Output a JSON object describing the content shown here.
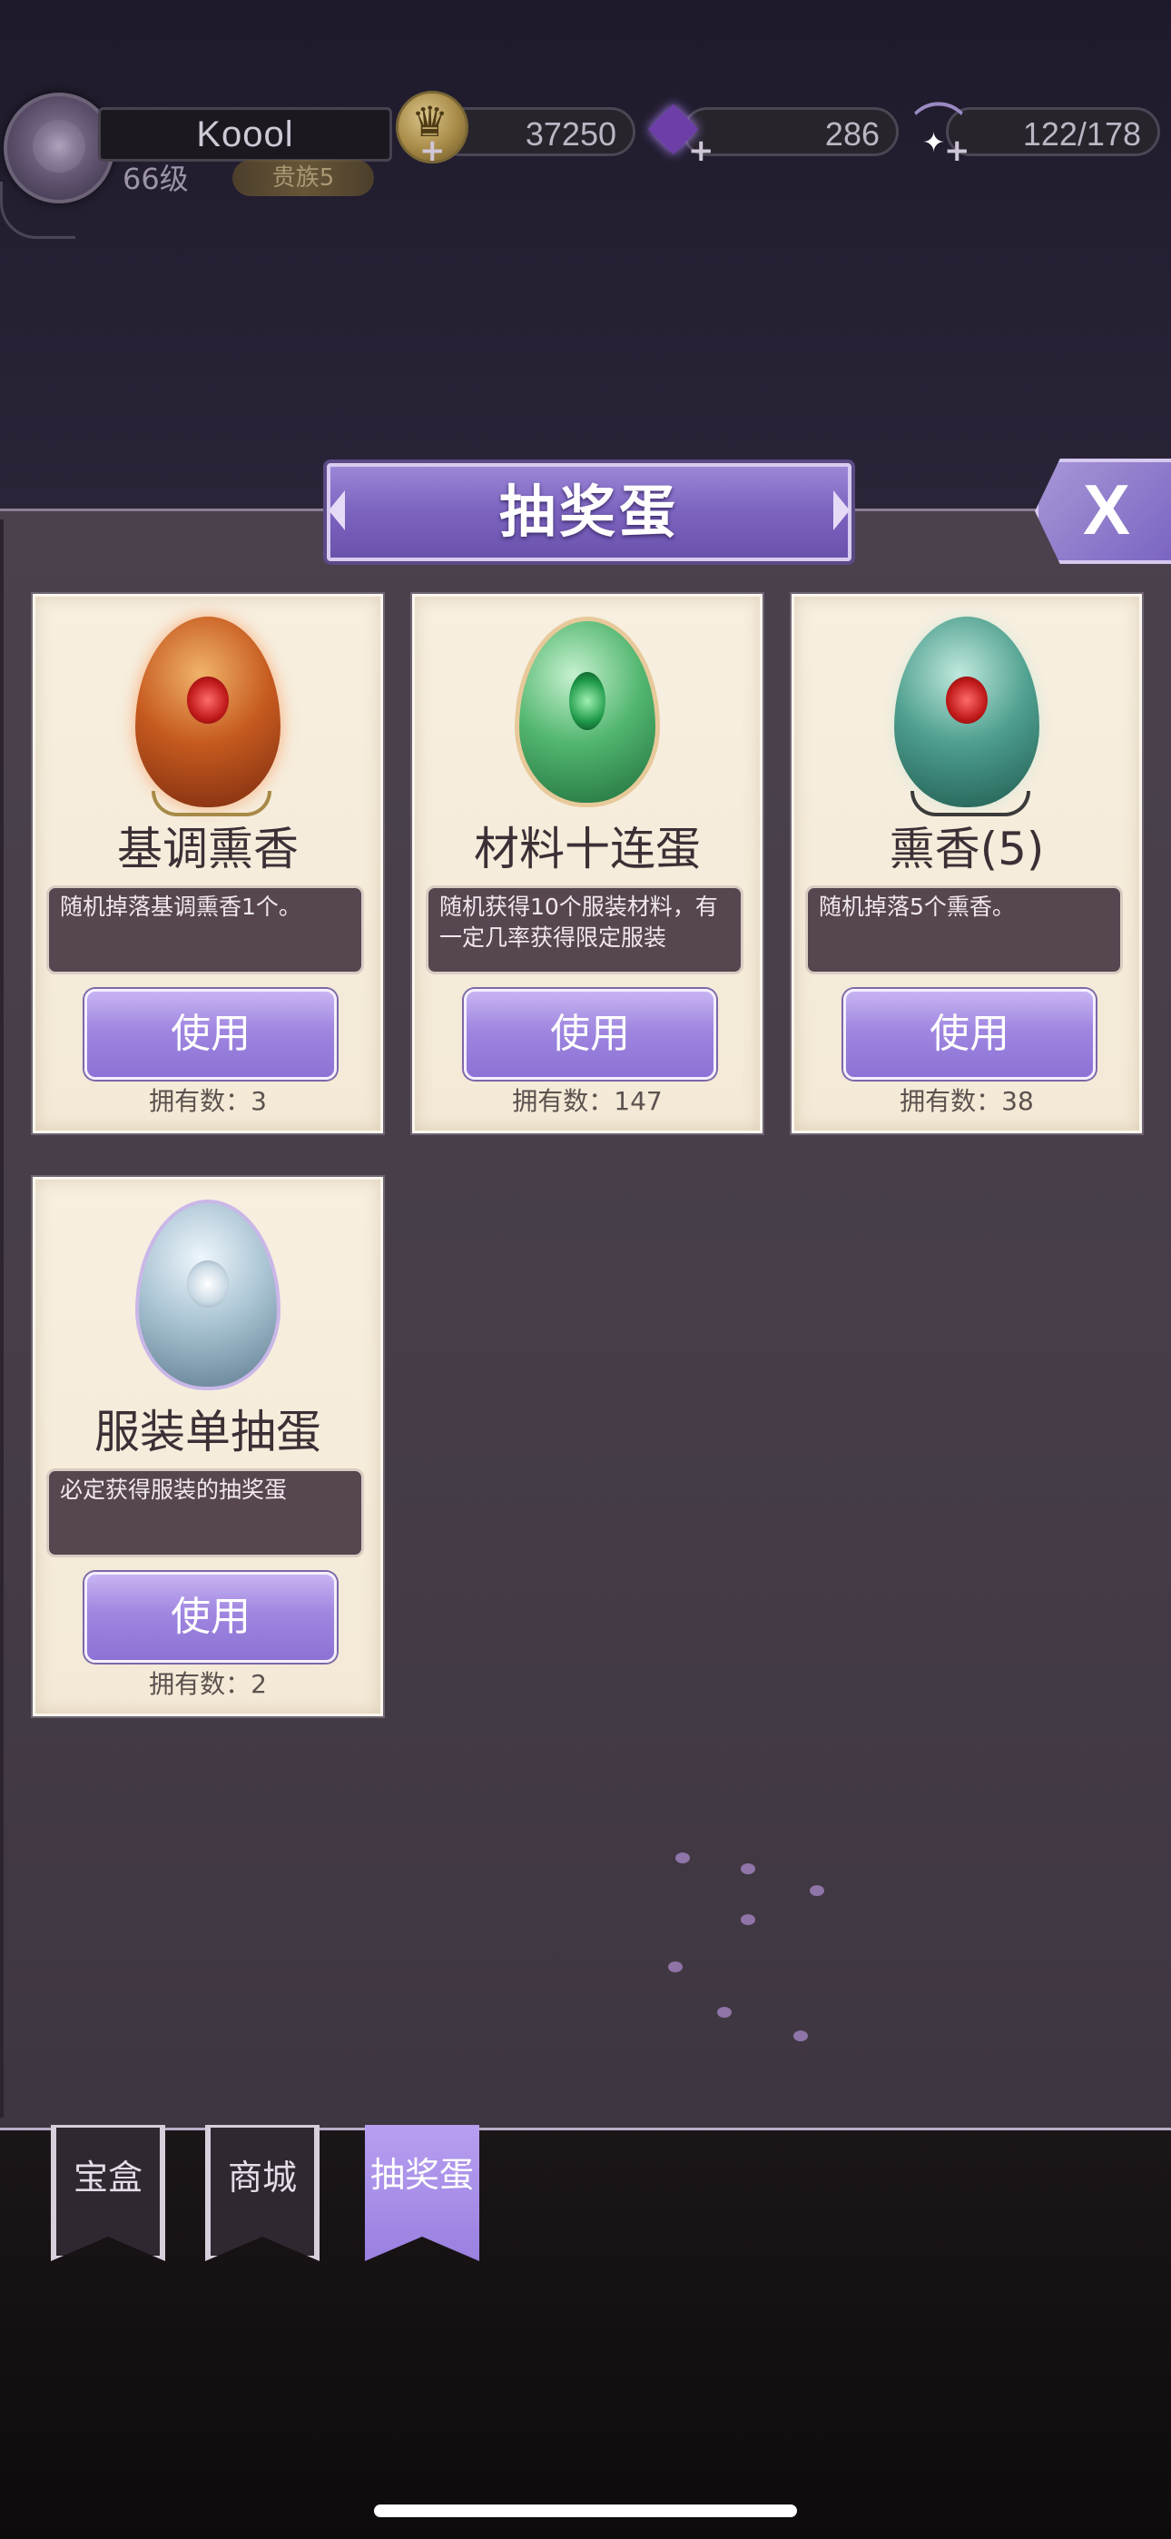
{
  "player": {
    "name": "Koool",
    "level": "66级",
    "rank": "贵族5"
  },
  "resources": {
    "gold": "37250",
    "gems": "286",
    "stamina": "122/178"
  },
  "panel": {
    "title": "抽奖蛋",
    "close_label": "X"
  },
  "cards": [
    {
      "name": "基调熏香",
      "desc": "随机掉落基调熏香1个。",
      "button": "使用",
      "owned": "拥有数：3",
      "egg_icon": "red-rose-egg"
    },
    {
      "name": "材料十连蛋",
      "desc": "随机获得10个服装材料，有一定几率获得限定服装",
      "button": "使用",
      "owned": "拥有数：147",
      "egg_icon": "green-emerald-egg"
    },
    {
      "name": "熏香(5)",
      "desc": "随机掉落5个熏香。",
      "button": "使用",
      "owned": "拥有数：38",
      "egg_icon": "teal-rose-egg"
    },
    {
      "name": "服装单抽蛋",
      "desc": "必定获得服装的抽奖蛋",
      "button": "使用",
      "owned": "拥有数：2",
      "egg_icon": "silver-egg"
    }
  ],
  "tabs": [
    {
      "label": "宝盒",
      "active": false
    },
    {
      "label": "商城",
      "active": false
    },
    {
      "label": "抽奖蛋",
      "active": true
    }
  ],
  "colors": {
    "accent": "#9a80e0",
    "card_bg": "#f5ecdb",
    "panel_bg": "#463d48"
  }
}
